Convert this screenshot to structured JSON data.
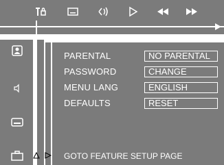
{
  "toolbar": {
    "icons": [
      "parental-lock-icon",
      "subtitle-icon",
      "audio-icon",
      "play-icon",
      "rewind-icon",
      "fast-forward-icon"
    ]
  },
  "sidebar": {
    "icons": [
      "user-icon",
      "speaker-icon",
      "subtitle-icon",
      "briefcase-icon"
    ]
  },
  "menu": {
    "rows": [
      {
        "label": "PARENTAL",
        "value": "NO PARENTAL"
      },
      {
        "label": "PASSWORD",
        "value": "CHANGE"
      },
      {
        "label": "MENU LANG",
        "value": "ENGLISH"
      },
      {
        "label": "DEFAULTS",
        "value": "RESET"
      }
    ]
  },
  "footer": {
    "hint": "GOTO FEATURE SETUP PAGE"
  },
  "colors": {
    "panel": "#7b7b7b",
    "text": "#ffffff"
  }
}
